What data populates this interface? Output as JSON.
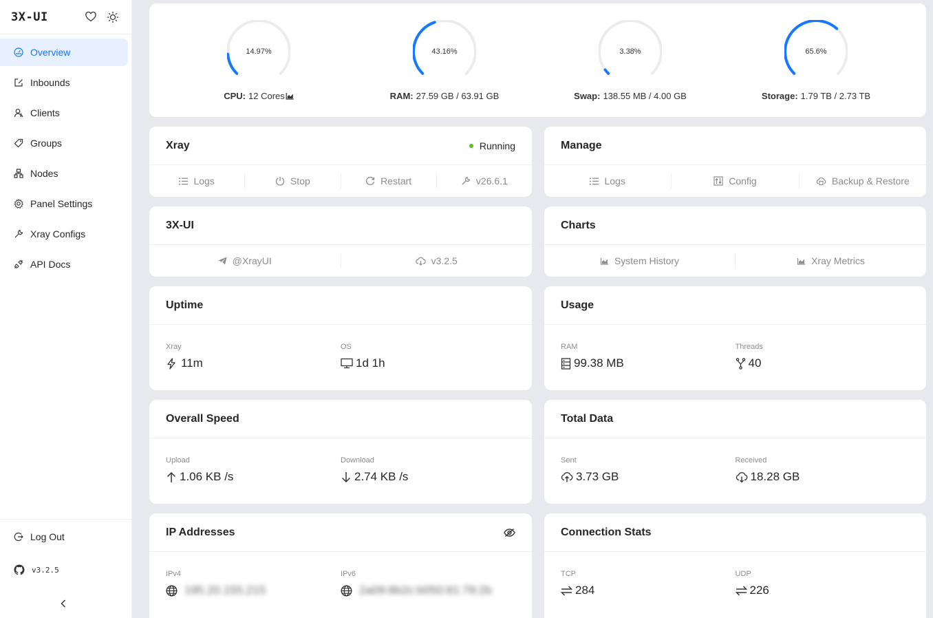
{
  "sidebar": {
    "title": "3X-UI",
    "items": [
      {
        "label": "Overview",
        "icon": "dashboard-icon"
      },
      {
        "label": "Inbounds",
        "icon": "edit-icon"
      },
      {
        "label": "Clients",
        "icon": "users-icon"
      },
      {
        "label": "Groups",
        "icon": "tag-icon"
      },
      {
        "label": "Nodes",
        "icon": "cluster-icon"
      },
      {
        "label": "Panel Settings",
        "icon": "gear-icon"
      },
      {
        "label": "Xray Configs",
        "icon": "tool-icon"
      },
      {
        "label": "API Docs",
        "icon": "api-icon"
      }
    ],
    "logout": "Log Out",
    "version": "v3.2.5"
  },
  "system": {
    "cpu": {
      "label": "CPU:",
      "value": "12 Cores",
      "percent": "14.97%",
      "fraction": 0.1497
    },
    "ram": {
      "label": "RAM:",
      "value": "27.59 GB / 63.91 GB",
      "percent": "43.16%",
      "fraction": 0.4316
    },
    "swap": {
      "label": "Swap:",
      "value": "138.55 MB / 4.00 GB",
      "percent": "3.38%",
      "fraction": 0.0338
    },
    "storage": {
      "label": "Storage:",
      "value": "1.79 TB / 2.73 TB",
      "percent": "65.6%",
      "fraction": 0.656
    }
  },
  "xray": {
    "title": "Xray",
    "status": "Running",
    "actions": [
      "Logs",
      "Stop",
      "Restart",
      "v26.6.1"
    ]
  },
  "manage": {
    "title": "Manage",
    "actions": [
      "Logs",
      "Config",
      "Backup & Restore"
    ]
  },
  "panel": {
    "title": "3X-UI",
    "actions": [
      "@XrayUI",
      "v3.2.5"
    ]
  },
  "charts": {
    "title": "Charts",
    "actions": [
      "System History",
      "Xray Metrics"
    ]
  },
  "uptime": {
    "title": "Uptime",
    "xray_label": "Xray",
    "xray_value": "11m",
    "os_label": "OS",
    "os_value": "1d 1h"
  },
  "usage": {
    "title": "Usage",
    "ram_label": "RAM",
    "ram_value": "99.38 MB",
    "threads_label": "Threads",
    "threads_value": "40"
  },
  "speed": {
    "title": "Overall Speed",
    "upload_label": "Upload",
    "upload_value": "1.06 KB /s",
    "download_label": "Download",
    "download_value": "2.74 KB /s"
  },
  "total": {
    "title": "Total Data",
    "sent_label": "Sent",
    "sent_value": "3.73 GB",
    "received_label": "Received",
    "received_value": "18.28 GB"
  },
  "ip": {
    "title": "IP Addresses",
    "ipv4_label": "IPv4",
    "ipv4_value": "195.20.155.215",
    "ipv6_label": "IPv6",
    "ipv6_value": "2a09:8b2c:b050:81:78:2b"
  },
  "conn": {
    "title": "Connection Stats",
    "tcp_label": "TCP",
    "tcp_value": "284",
    "udp_label": "UDP",
    "udp_value": "226"
  },
  "colors": {
    "accent": "#1677ff",
    "running": "#52c41a",
    "track": "#ececec"
  }
}
